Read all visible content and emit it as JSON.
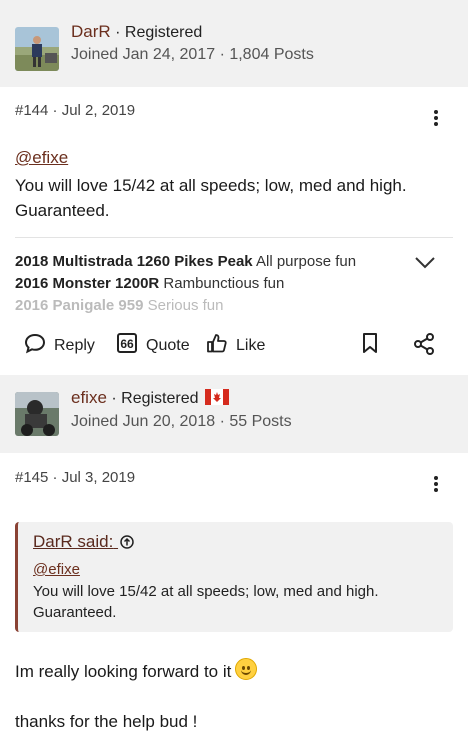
{
  "post1": {
    "user": {
      "name": "DarR",
      "role": "Registered",
      "joined": "Joined Jan 24, 2017 · 1,804 Posts"
    },
    "meta": "#144 · Jul 2, 2019",
    "mention": "@efixe",
    "body": "You will love 15/42 at all speeds; low, med and high. Guaranteed.",
    "signature": [
      {
        "bike": "2018 Multistrada 1260 Pikes Peak",
        "note": "All purpose fun"
      },
      {
        "bike": "2016 Monster 1200R",
        "note": "Rambunctious fun"
      },
      {
        "bike": "2016 Panigale 959",
        "note": "Serious fun"
      }
    ]
  },
  "actions": {
    "reply": "Reply",
    "quote": "Quote",
    "like": "Like"
  },
  "post2": {
    "user": {
      "name": "efixe",
      "role": "Registered",
      "joined": "Joined Jun 20, 2018 · 55 Posts"
    },
    "meta": "#145 · Jul 3, 2019",
    "quote": {
      "author": "DarR said:",
      "mention": "@efixe",
      "text": "You will love 15/42 at all speeds; low, med and high. Guaranteed."
    },
    "body1": "Im really looking forward to it",
    "body2": "thanks for the help bud !"
  },
  "icons": [
    "user-avatar",
    "kebab-menu-icon",
    "chevron-down-icon",
    "reply-icon",
    "quote-icon",
    "like-icon",
    "bookmark-icon",
    "share-icon",
    "canada-flag-icon",
    "arrow-up-circle-icon",
    "smile-emoji-icon"
  ],
  "colors": {
    "accent": "#6b2f1e",
    "header_bg": "#f1f1f1",
    "quote_border": "#8a4234"
  }
}
